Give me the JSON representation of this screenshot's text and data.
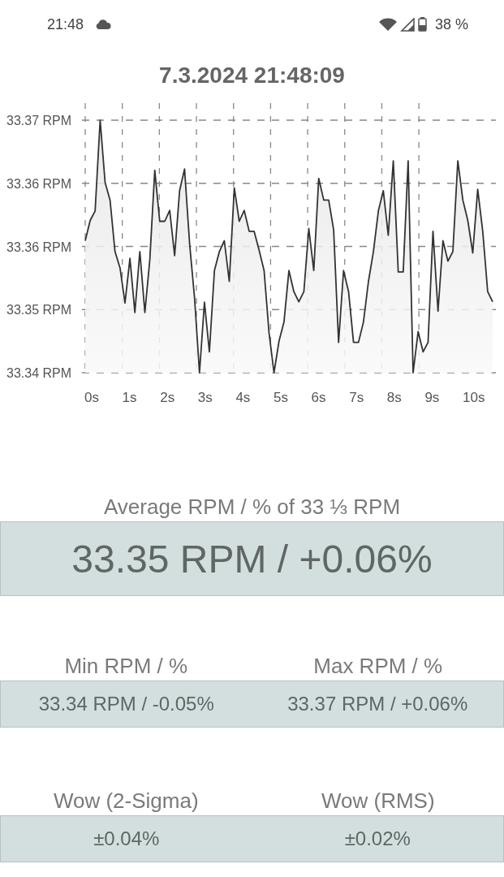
{
  "status_bar": {
    "time": "21:48",
    "battery": "38 %"
  },
  "title": "7.3.2024 21:48:09",
  "chart": {
    "y_axis_labels": [
      "33.37 RPM",
      "33.36 RPM",
      "33.36 RPM",
      "33.35 RPM",
      "33.34 RPM"
    ],
    "x_axis_labels": [
      "0s",
      "1s",
      "2s",
      "3s",
      "4s",
      "5s",
      "6s",
      "7s",
      "8s",
      "9s",
      "10s"
    ]
  },
  "average": {
    "label": "Average RPM / % of 33 ⅓ RPM",
    "value": "33.35 RPM / +0.06%"
  },
  "stat_rows": [
    [
      {
        "label": "Min RPM / %",
        "value": "33.34 RPM / -0.05%"
      },
      {
        "label": "Max RPM / %",
        "value": "33.37 RPM / +0.06%"
      }
    ],
    [
      {
        "label": "Wow (2-Sigma)",
        "value": "±0.04%"
      },
      {
        "label": "Wow (RMS)",
        "value": "±0.02%"
      }
    ]
  ]
}
